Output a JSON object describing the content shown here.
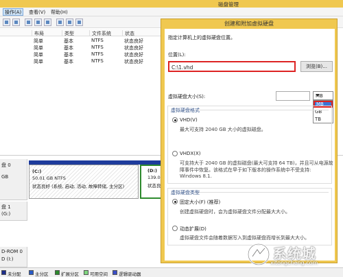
{
  "window": {
    "title": "磁盘管理",
    "menu": [
      "操作(A)",
      "查看(V)",
      "帮助(H)"
    ]
  },
  "volume_table": {
    "columns": [
      "布局",
      "类型",
      "文件系统",
      "状态"
    ],
    "rows": [
      {
        "layout": "简单",
        "type": "基本",
        "fs": "NTFS",
        "status": "状态良好"
      },
      {
        "layout": "简单",
        "type": "基本",
        "fs": "NTFS",
        "status": "状态良好"
      },
      {
        "layout": "简单",
        "type": "基本",
        "fs": "NTFS",
        "status": "状态良好"
      },
      {
        "layout": "简单",
        "type": "基本",
        "fs": "NTFS",
        "status": "状态良好"
      }
    ]
  },
  "disks": {
    "disk0": {
      "name": "盘 0",
      "size": "GB"
    },
    "partition_c": {
      "label": "(C:)",
      "size": "50.01 GB NTFS",
      "status": "状态良好 (系统, 启动, 活动, 故障转储, 主分区)"
    },
    "partition_d": {
      "label": "(D:)",
      "size": "139.01",
      "status": "状态良好"
    },
    "disk1": {
      "name": "盘 1",
      "sub": "(G:)"
    },
    "cdrom": {
      "name": "D-ROM 0",
      "sub": "D (I:)"
    }
  },
  "legend": [
    {
      "color": "#1e2e8c",
      "label": "未分配"
    },
    {
      "color": "#2a5cc7",
      "label": "主分区"
    },
    {
      "color": "#2d8a2d",
      "label": "扩展分区"
    },
    {
      "color": "#7fd67f",
      "label": "可用空间"
    },
    {
      "color": "#3b4ec7",
      "label": "逻辑驱动器"
    }
  ],
  "dialog": {
    "title": "创建和附加虚拟硬盘",
    "intro": "指定计算机上的虚拟硬盘位置。",
    "location_label": "位置(L):",
    "location_value": "C:\\1.vhd",
    "browse_label": "浏览(B)...",
    "size_label": "虚拟硬盘大小(S):",
    "size_value": "",
    "unit_selected": "MB",
    "unit_options": [
      "MB",
      "GB",
      "TB"
    ],
    "format_section": "虚拟硬盘格式",
    "vhd_label": "VHD(V)",
    "vhd_desc": "最大可支持 2040 GB 大小的虚拟磁盘。",
    "vhdx_label": "VHDX(X)",
    "vhdx_desc_1": "可支持大于 2040 GB 的虚拟磁盘(最大可支持 64 TB)，并且可从电源故",
    "vhdx_desc_2": "障事件中恢复。该格式在早于如下版本的操作系统中不受支持:",
    "vhdx_desc_3": "Windows 8.1.",
    "type_section": "虚拟硬盘类型",
    "fixed_label": "固定大小(F) (推荐)",
    "fixed_desc": "创建虚拟硬盘时，会为虚拟硬盘文件分配最大大小。",
    "dynamic_label": "动态扩展(D)",
    "dynamic_desc_1": "虚拟硬盘文件会随着数据写入到虚拟硬盘而增长到最大大小。"
  },
  "watermark": {
    "cn": "系统城",
    "en": "xitongcheng.com"
  }
}
